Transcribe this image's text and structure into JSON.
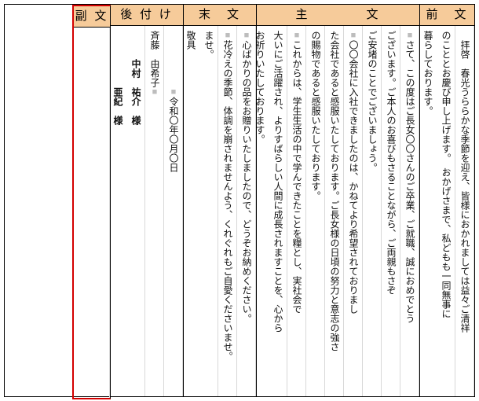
{
  "sections": [
    {
      "id": "zenbun",
      "header": "前　文",
      "highlight": false,
      "columns": [
        "　拝啓　春光うららかな季節を迎え、皆様におかれましては益々ご清祥",
        "のこととお慶び申し上げます。　おかげさまで、私どもも一同無事に",
        "暮らしております。"
      ]
    },
    {
      "id": "shubun",
      "header": "主　　　　文",
      "highlight": false,
      "columns": [
        "□さて、この度はご長女〇〇さんのご卒業、ご就職、誠におめでとう",
        "ございます。ご本人のお喜びもさることながら、ご両親もさぞ",
        "ご安堵のことでございましょう。",
        "□〇〇会社に入社できましたのは、かねてより希望されておりまし",
        "た会社であると感服いたしております。ご長女様の日頃の努力と意志の強さ",
        "の賜物であると感服いたしております。",
        "□これからは、学生生活の中で学んできたことを糧とし、実社会で",
        "大いにご活躍され、よりすばらしい人間に成長されますことを、心から",
        "お祈りいたしております。"
      ]
    },
    {
      "id": "matsubun",
      "header": "末　文",
      "highlight": false,
      "columns": [
        "□心ばかりの品をお贈りいたしましたので、どうぞお納めください。",
        "□花冷えの季節、体調を崩されませんよう、くれぐれもご自愛くださいませ。",
        "ませ。",
        {
          "text": "敬具",
          "align": "bottom",
          "pad": true
        }
      ]
    },
    {
      "id": "atozuke",
      "header": "後 付 け",
      "highlight": false,
      "columns": [
        {
          "text": "□令和〇年〇月〇日",
          "pad": true,
          "indent": 6
        },
        {
          "text": "斉藤　由希子□",
          "align": "bottom",
          "pad": true
        },
        {
          "text": "中村　祐介　様",
          "indent": 3,
          "bold": true
        },
        {
          "text": "　　　亜紀　様",
          "indent": 3,
          "bold": true
        }
      ]
    },
    {
      "id": "fukubun",
      "header": "副 文",
      "highlight": true,
      "columns": [
        "",
        ""
      ]
    }
  ]
}
